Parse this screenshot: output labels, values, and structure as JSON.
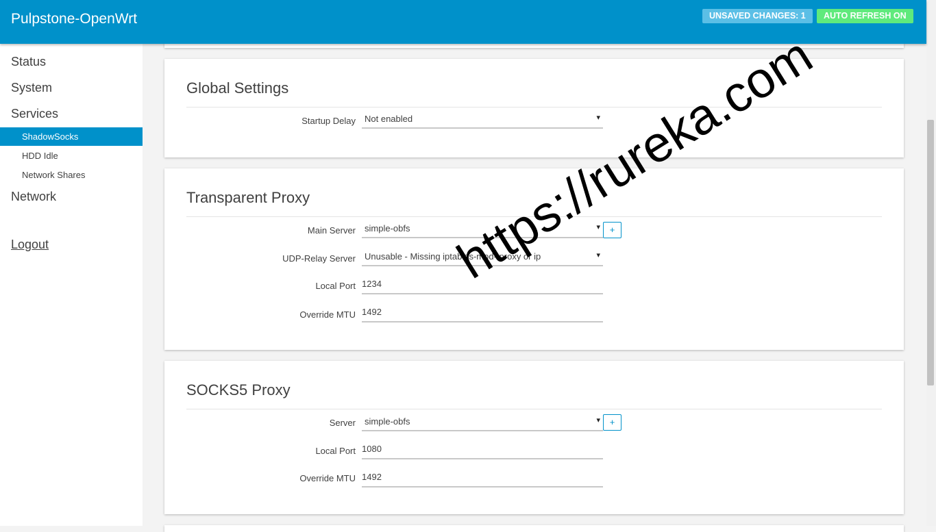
{
  "header": {
    "brand": "Pulpstone-OpenWrt",
    "unsaved_badge": "UNSAVED CHANGES: 1",
    "refresh_badge": "AUTO REFRESH ON"
  },
  "sidebar": {
    "items": [
      {
        "label": "Status"
      },
      {
        "label": "System"
      },
      {
        "label": "Services"
      },
      {
        "label": "ShadowSocks",
        "active": true
      },
      {
        "label": "HDD Idle"
      },
      {
        "label": "Network Shares"
      },
      {
        "label": "Network"
      }
    ],
    "logout": "Logout"
  },
  "global_settings": {
    "title": "Global Settings",
    "startup_delay_label": "Startup Delay",
    "startup_delay_value": "Not enabled"
  },
  "transparent_proxy": {
    "title": "Transparent Proxy",
    "main_server_label": "Main Server",
    "main_server_value": "simple-obfs",
    "udp_relay_label": "UDP-Relay Server",
    "udp_relay_value": "Unusable - Missing iptables-mod-tproxy or ip",
    "local_port_label": "Local Port",
    "local_port_value": "1234",
    "mtu_label": "Override MTU",
    "mtu_value": "1492",
    "add_label": "+"
  },
  "socks5_proxy": {
    "title": "SOCKS5 Proxy",
    "server_label": "Server",
    "server_value": "simple-obfs",
    "local_port_label": "Local Port",
    "local_port_value": "1080",
    "mtu_label": "Override MTU",
    "mtu_value": "1492",
    "add_label": "+"
  },
  "icons": {
    "caret": "▾"
  },
  "watermark": "https://rureka.com",
  "colors": {
    "accent": "#0091ca",
    "unsaved": "#5bbfe6",
    "refresh": "#5fea7c"
  }
}
